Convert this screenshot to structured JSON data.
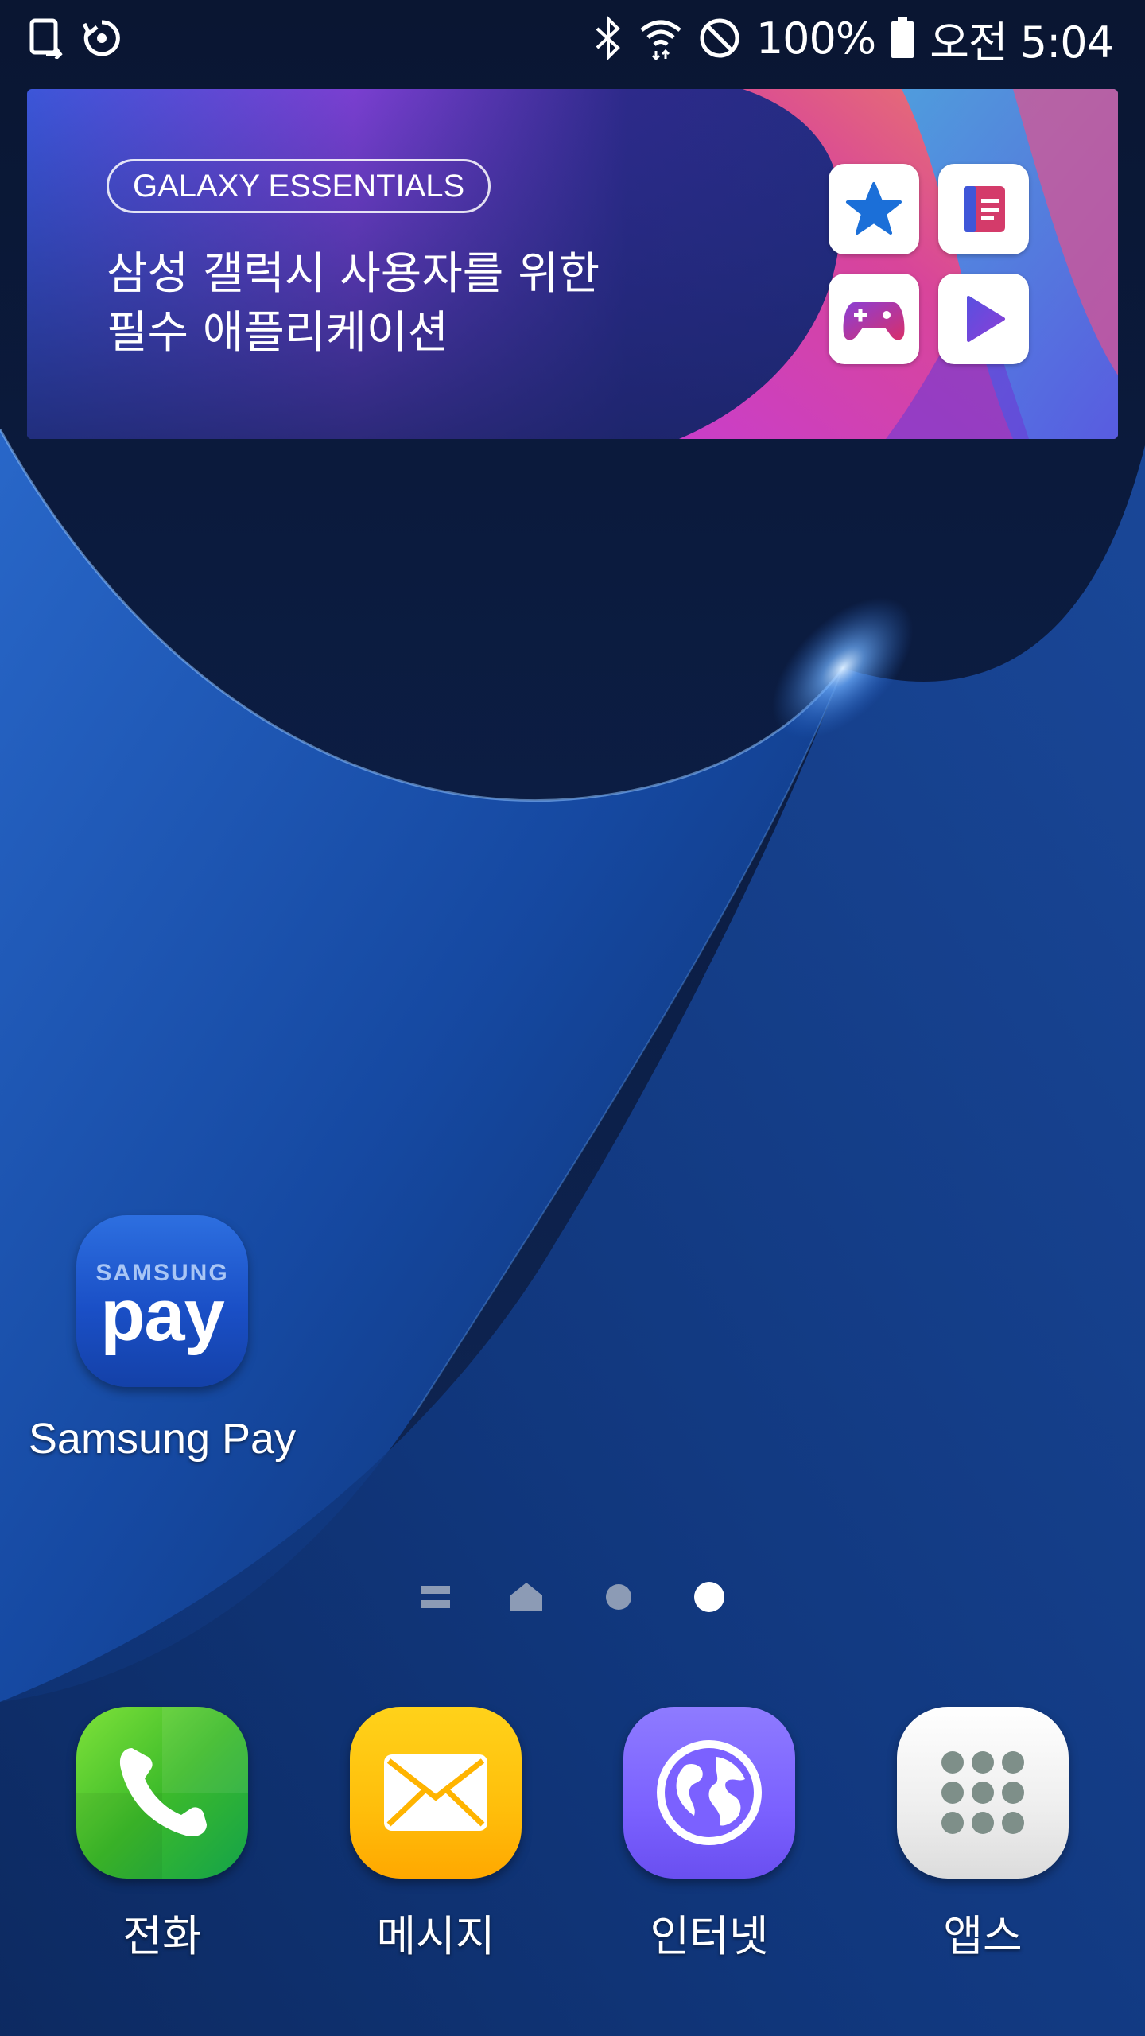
{
  "status_bar": {
    "left_icons": [
      "screen-mirror-icon",
      "sync-icon"
    ],
    "right_icons": [
      "bluetooth-icon",
      "wifi-icon",
      "do-not-disturb-icon",
      "battery-icon"
    ],
    "battery_percent": "100%",
    "time": "오전 5:04",
    "battery_level": 1.0
  },
  "widget": {
    "tag": "GALAXY ESSENTIALS",
    "title_line1": "삼성 갤럭시 사용자를 위한",
    "title_line2": "필수 애플리케이션",
    "app_icons": [
      "star-icon",
      "book-icon",
      "gamepad-icon",
      "play-icon"
    ]
  },
  "shortcut": {
    "brand": "SAMSUNG",
    "word": "pay",
    "label": "Samsung Pay"
  },
  "page_indicator": {
    "items": [
      "menu-icon",
      "home-icon",
      "page-dot",
      "page-dot-active"
    ],
    "active_index": 3
  },
  "dock": {
    "phone": {
      "label": "전화",
      "icon": "phone-icon",
      "color": "#3dbb2a"
    },
    "messages": {
      "label": "메시지",
      "icon": "envelope-icon",
      "color": "#ffc107"
    },
    "internet": {
      "label": "인터넷",
      "icon": "globe-icon",
      "color": "#7b61ff"
    },
    "apps": {
      "label": "앱스",
      "icon": "grid-icon",
      "color": "#e6e6e6"
    }
  },
  "colors": {
    "wallpaper_dark": "#0b1a3c",
    "wallpaper_blue": "#1e5bb8",
    "widget_purple": "#5b2fb5"
  }
}
